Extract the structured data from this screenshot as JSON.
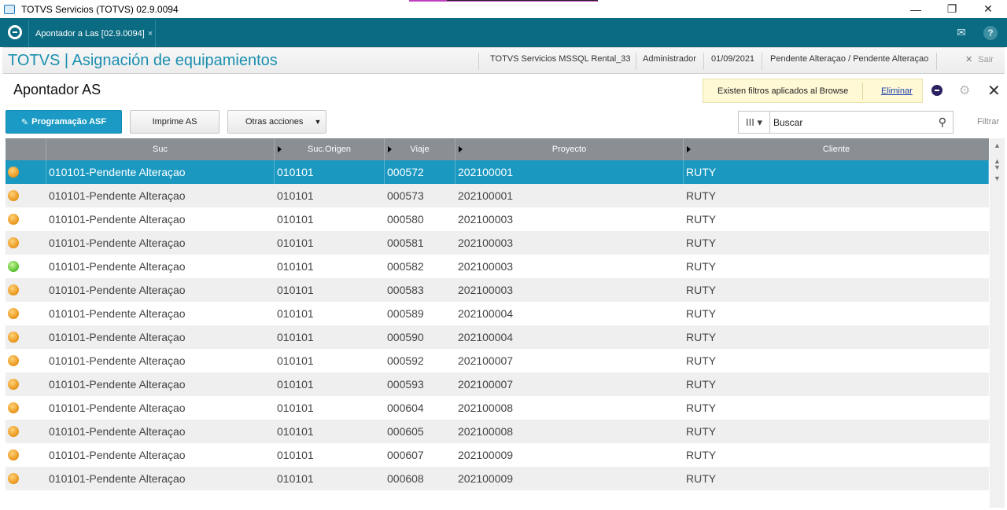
{
  "window": {
    "title": "TOTVS Servicios (TOTVS) 02.9.0094",
    "min": "—",
    "restore": "❐",
    "close": "✕"
  },
  "tabbar": {
    "tab_label": "Apontador a Las [02.9.0094]",
    "tab_close": "×",
    "mail_icon": "✉",
    "help_icon": "?"
  },
  "header": {
    "app_title": "TOTVS | Asignación de equipamientos",
    "environment": "TOTVS Servicios MSSQL Rental_33",
    "user": "Administrador",
    "date": "01/09/2021",
    "branch": "Pendente Alteraçao / Pendente Alteraçao",
    "exit": "Sair",
    "exit_icon": "✕"
  },
  "browse": {
    "title": "Apontador AS",
    "filter_note": "Existen filtros aplicados al Browse",
    "filter_remove": "Eliminar",
    "close_icon": "✕",
    "gear_icon": "⚙"
  },
  "actions": {
    "primary": "Programação ASF",
    "print": "Imprime AS",
    "other": "Otras acciones",
    "other_caret": "▼",
    "pencil_icon": "✎"
  },
  "search": {
    "value": "Buscar",
    "columns_icon": "III ▾",
    "search_icon": "⚲",
    "filter_label": "Filtrar"
  },
  "columns": [
    "Suc",
    "Suc.Origen",
    "Viaje",
    "Proyecto",
    "Cliente"
  ],
  "rows": [
    {
      "status": "orange",
      "suc": "010101-Pendente Alteraçao",
      "origen": "010101",
      "viaje": "000572",
      "proyecto": "202100001",
      "cliente": "RUTY"
    },
    {
      "status": "orange",
      "suc": "010101-Pendente Alteraçao",
      "origen": "010101",
      "viaje": "000573",
      "proyecto": "202100001",
      "cliente": "RUTY"
    },
    {
      "status": "orange",
      "suc": "010101-Pendente Alteraçao",
      "origen": "010101",
      "viaje": "000580",
      "proyecto": "202100003",
      "cliente": "RUTY"
    },
    {
      "status": "orange",
      "suc": "010101-Pendente Alteraçao",
      "origen": "010101",
      "viaje": "000581",
      "proyecto": "202100003",
      "cliente": "RUTY"
    },
    {
      "status": "green",
      "suc": "010101-Pendente Alteraçao",
      "origen": "010101",
      "viaje": "000582",
      "proyecto": "202100003",
      "cliente": "RUTY"
    },
    {
      "status": "orange",
      "suc": "010101-Pendente Alteraçao",
      "origen": "010101",
      "viaje": "000583",
      "proyecto": "202100003",
      "cliente": "RUTY"
    },
    {
      "status": "orange",
      "suc": "010101-Pendente Alteraçao",
      "origen": "010101",
      "viaje": "000589",
      "proyecto": "202100004",
      "cliente": "RUTY"
    },
    {
      "status": "orange",
      "suc": "010101-Pendente Alteraçao",
      "origen": "010101",
      "viaje": "000590",
      "proyecto": "202100004",
      "cliente": "RUTY"
    },
    {
      "status": "orange",
      "suc": "010101-Pendente Alteraçao",
      "origen": "010101",
      "viaje": "000592",
      "proyecto": "202100007",
      "cliente": "RUTY"
    },
    {
      "status": "orange",
      "suc": "010101-Pendente Alteraçao",
      "origen": "010101",
      "viaje": "000593",
      "proyecto": "202100007",
      "cliente": "RUTY"
    },
    {
      "status": "orange",
      "suc": "010101-Pendente Alteraçao",
      "origen": "010101",
      "viaje": "000604",
      "proyecto": "202100008",
      "cliente": "RUTY"
    },
    {
      "status": "orange",
      "suc": "010101-Pendente Alteraçao",
      "origen": "010101",
      "viaje": "000605",
      "proyecto": "202100008",
      "cliente": "RUTY"
    },
    {
      "status": "orange",
      "suc": "010101-Pendente Alteraçao",
      "origen": "010101",
      "viaje": "000607",
      "proyecto": "202100009",
      "cliente": "RUTY"
    },
    {
      "status": "orange",
      "suc": "010101-Pendente Alteraçao",
      "origen": "010101",
      "viaje": "000608",
      "proyecto": "202100009",
      "cliente": "RUTY"
    }
  ],
  "selected_row": 0,
  "colors": {
    "accent": "#1a98c0",
    "tabbar": "#0b6b82",
    "status_orange": "#e99419",
    "status_green": "#55c02b"
  }
}
